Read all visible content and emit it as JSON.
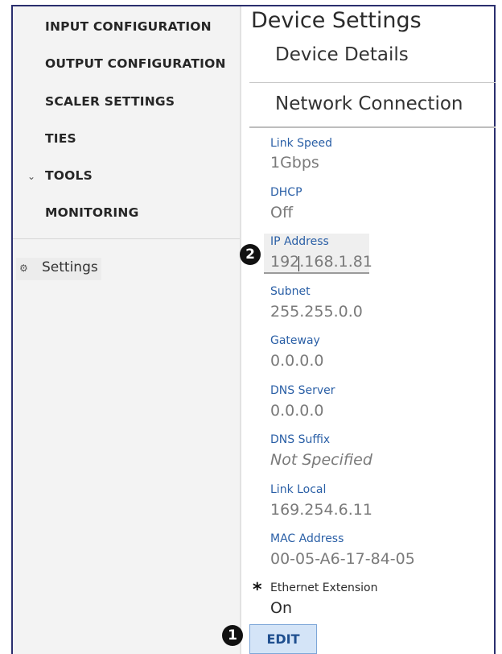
{
  "sidebar": {
    "items": [
      {
        "label": "INPUT CONFIGURATION"
      },
      {
        "label": "OUTPUT CONFIGURATION"
      },
      {
        "label": "SCALER SETTINGS"
      },
      {
        "label": "TIES"
      },
      {
        "label": "TOOLS",
        "expandable": true
      },
      {
        "label": "MONITORING"
      }
    ],
    "settings_label": "Settings",
    "settings_icon": "gear-icon",
    "tools_icon": "chevron-down-icon"
  },
  "main": {
    "title": "Device Settings",
    "tabs": [
      {
        "label": "Device Details"
      },
      {
        "label": "Network Connection"
      }
    ],
    "fields": [
      {
        "label": "Link Speed",
        "value": "1Gbps"
      },
      {
        "label": "DHCP",
        "value": "Off"
      },
      {
        "label": "IP Address",
        "value": "192.168.1.81"
      },
      {
        "label": "Subnet",
        "value": "255.255.0.0"
      },
      {
        "label": "Gateway",
        "value": "0.0.0.0"
      },
      {
        "label": "DNS Server",
        "value": "0.0.0.0"
      },
      {
        "label": "DNS Suffix",
        "value": "Not Specified"
      },
      {
        "label": "Link Local",
        "value": "169.254.6.11"
      },
      {
        "label": "MAC Address",
        "value": "00-05-A6-17-84-05"
      },
      {
        "label": "Ethernet Extension",
        "value": "On"
      }
    ],
    "edit_label": "EDIT"
  },
  "callouts": {
    "one": "1",
    "two": "2",
    "asterisk": "*"
  }
}
